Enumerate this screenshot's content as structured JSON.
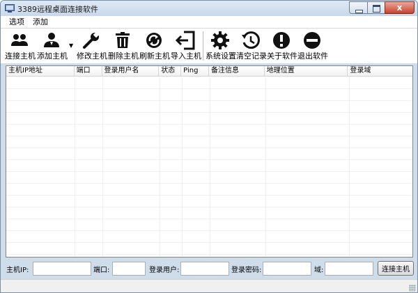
{
  "window": {
    "title": "3389远程桌面连接软件",
    "close_glyph": "x"
  },
  "menubar": {
    "items": [
      "选项",
      "添加"
    ]
  },
  "toolbar": {
    "buttons": [
      {
        "label": "连接主机",
        "icon": "users-icon"
      },
      {
        "label": "添加主机",
        "icon": "add-user-icon"
      },
      {
        "label": "修改主机",
        "icon": "wrench-icon"
      },
      {
        "label": "删除主机",
        "icon": "trash-icon"
      },
      {
        "label": "刷新主机",
        "icon": "refresh-icon"
      },
      {
        "label": "导入主机",
        "icon": "import-icon"
      },
      {
        "label": "系统设置",
        "icon": "gear-icon"
      },
      {
        "label": "清空记录",
        "icon": "history-icon"
      },
      {
        "label": "关于软件",
        "icon": "info-icon"
      },
      {
        "label": "退出软件",
        "icon": "exit-icon"
      }
    ],
    "dropdown_glyph": "▼"
  },
  "table": {
    "columns": [
      "主机IP地址",
      "端口",
      "登录用户名",
      "状态",
      "Ping",
      "备注信息",
      "地理位置",
      "登录域"
    ],
    "rows": []
  },
  "inputbar": {
    "host_ip_label": "主机IP:",
    "port_label": "端口:",
    "user_label": "登录用户:",
    "password_label": "登录密码:",
    "domain_label": "域:",
    "host_ip_value": "",
    "port_value": "",
    "user_value": "",
    "password_value": "",
    "domain_value": "",
    "connect_button": "连接主机"
  },
  "colors": {
    "frame": "#cfdcea",
    "close_button": "#c7432d",
    "icon": "#111111"
  }
}
